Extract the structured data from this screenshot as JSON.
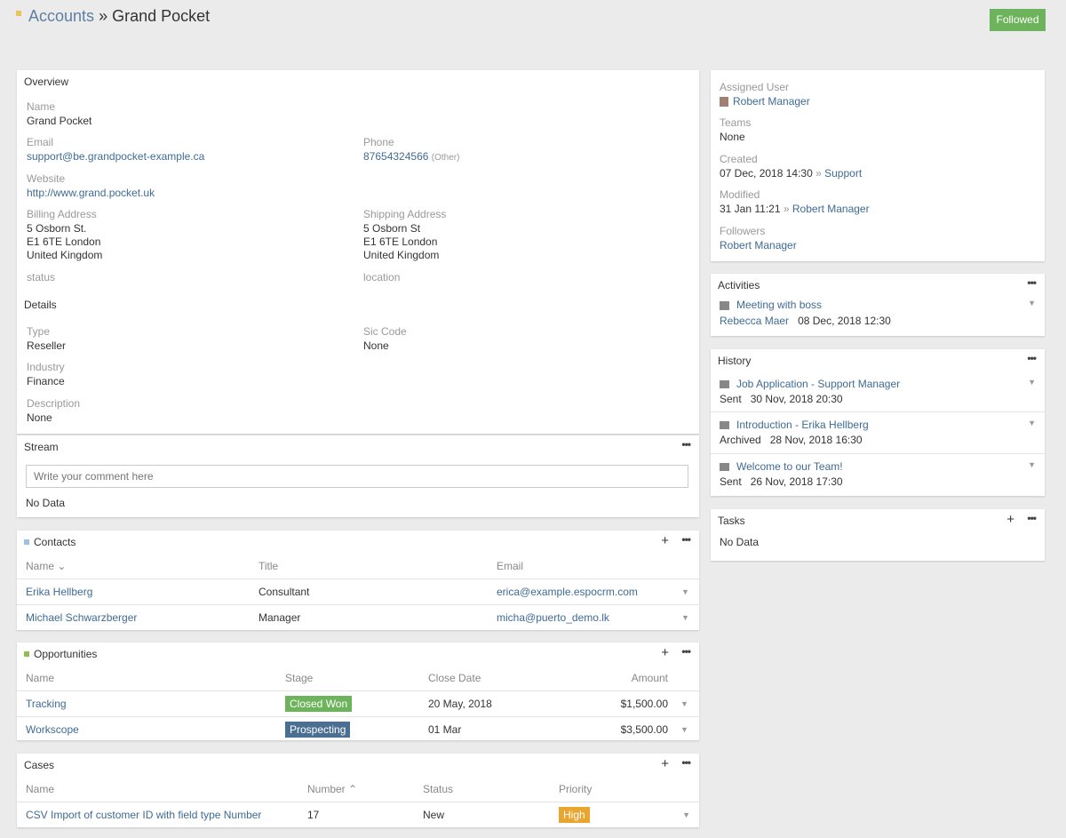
{
  "header": {
    "crumb": "Accounts",
    "separator": "»",
    "title": "Grand Pocket",
    "followed": "Followed"
  },
  "overview": {
    "title": "Overview",
    "name_label": "Name",
    "name": "Grand Pocket",
    "email_label": "Email",
    "email": "support@be.grandpocket-example.ca",
    "phone_label": "Phone",
    "phone": "87654324566",
    "phone_type": "(Other)",
    "website_label": "Website",
    "website": "http://www.grand.pocket.uk",
    "billing_label": "Billing Address",
    "billing": [
      "5 Osborn St.",
      "E1 6TE London",
      "United Kingdom"
    ],
    "shipping_label": "Shipping Address",
    "shipping": [
      "5 Osborn St",
      "E1 6TE London",
      "United Kingdom"
    ],
    "status_label": "status",
    "location_label": "location"
  },
  "details": {
    "title": "Details",
    "type_label": "Type",
    "type": "Reseller",
    "sic_label": "Sic Code",
    "sic": "None",
    "industry_label": "Industry",
    "industry": "Finance",
    "description_label": "Description",
    "description": "None"
  },
  "stream": {
    "title": "Stream",
    "placeholder": "Write your comment here",
    "empty": "No Data"
  },
  "contacts": {
    "title": "Contacts",
    "columns": [
      "Name",
      "Title",
      "Email"
    ],
    "rows": [
      {
        "name": "Erika Hellberg",
        "title": "Consultant",
        "email": "erica@example.espocrm.com"
      },
      {
        "name": "Michael Schwarzberger",
        "title": "Manager",
        "email": "micha@puerto_demo.lk"
      }
    ]
  },
  "opportunities": {
    "title": "Opportunities",
    "columns": [
      "Name",
      "Stage",
      "Close Date",
      "Amount"
    ],
    "rows": [
      {
        "name": "Tracking",
        "stage": "Closed Won",
        "stage_color": "#6db35b",
        "date": "20 May, 2018",
        "amount": "$1,500.00"
      },
      {
        "name": "Workscope",
        "stage": "Prospecting",
        "stage_color": "#4a6f92",
        "date": "01 Mar",
        "amount": "$3,500.00"
      }
    ]
  },
  "cases": {
    "title": "Cases",
    "columns": [
      "Name",
      "Number",
      "Status",
      "Priority"
    ],
    "rows": [
      {
        "name": "CSV Import of customer ID with field type Number",
        "number": "17",
        "status": "New",
        "priority": "High"
      }
    ]
  },
  "side": {
    "assigned_label": "Assigned User",
    "assigned": "Robert Manager",
    "teams_label": "Teams",
    "teams": "None",
    "created_label": "Created",
    "created": "07 Dec, 2018 14:30",
    "created_by": "Support",
    "modified_label": "Modified",
    "modified": "31 Jan 11:21",
    "modified_by": "Robert Manager",
    "followers_label": "Followers",
    "followers": "Robert Manager",
    "sep": "»"
  },
  "activities": {
    "title": "Activities",
    "items": [
      {
        "name": "Meeting with boss",
        "user": "Rebecca Maer",
        "date": "08 Dec, 2018 12:30"
      }
    ]
  },
  "history": {
    "title": "History",
    "items": [
      {
        "name": "Job Application - Support Manager",
        "status": "Sent",
        "date": "30 Nov, 2018 20:30"
      },
      {
        "name": "Introduction - Erika Hellberg",
        "status": "Archived",
        "date": "28 Nov, 2018 16:30"
      },
      {
        "name": "Welcome to our Team!",
        "status": "Sent",
        "date": "26 Nov, 2018 17:30"
      }
    ]
  },
  "tasks": {
    "title": "Tasks",
    "empty": "No Data"
  },
  "icons": {
    "more": "•••",
    "plus": "+",
    "caret": "▼",
    "sort_down": "⌄",
    "sort_up": "⌃"
  }
}
